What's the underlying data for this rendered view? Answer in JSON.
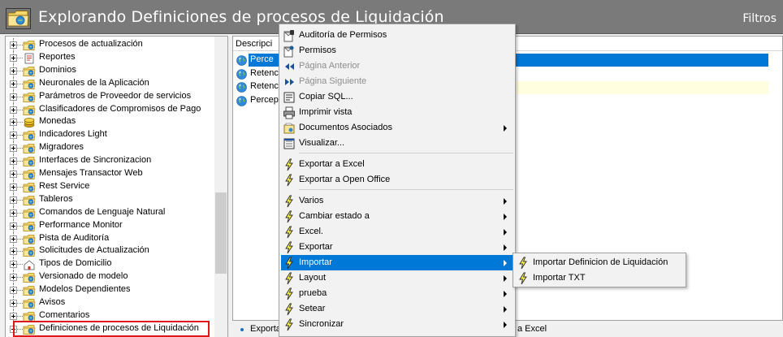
{
  "window": {
    "title": "Explorando Definiciones de procesos de Liquidación",
    "filters_label": "Filtros"
  },
  "tree": {
    "items": [
      {
        "label": "Procesos de actualización",
        "icon": "folder-icon"
      },
      {
        "label": "Reportes",
        "icon": "report-icon"
      },
      {
        "label": "Dominios",
        "icon": "folder-icon"
      },
      {
        "label": "Neuronales de la Aplicación",
        "icon": "folder-icon"
      },
      {
        "label": "Parámetros de Proveedor de servicios",
        "icon": "folder-icon"
      },
      {
        "label": "Clasificadores de Compromisos de Pago",
        "icon": "folder-icon"
      },
      {
        "label": "Monedas",
        "icon": "coins-icon"
      },
      {
        "label": "Indicadores Light",
        "icon": "folder-icon"
      },
      {
        "label": "Migradores",
        "icon": "folder-icon"
      },
      {
        "label": "Interfaces de Sincronizacion",
        "icon": "folder-icon"
      },
      {
        "label": "Mensajes Transactor Web",
        "icon": "folder-icon"
      },
      {
        "label": "Rest Service",
        "icon": "folder-icon"
      },
      {
        "label": "Tableros",
        "icon": "folder-icon"
      },
      {
        "label": "Comandos de Lenguaje Natural",
        "icon": "folder-icon"
      },
      {
        "label": "Performance Monitor",
        "icon": "folder-icon"
      },
      {
        "label": "Pista de Auditoría",
        "icon": "folder-icon"
      },
      {
        "label": "Solicitudes de Actualización",
        "icon": "folder-icon"
      },
      {
        "label": "Tipos de Domicilio",
        "icon": "domicile-icon"
      },
      {
        "label": "Versionado de modelo",
        "icon": "folder-icon"
      },
      {
        "label": "Modelos Dependientes",
        "icon": "folder-icon"
      },
      {
        "label": "Avisos",
        "icon": "folder-icon"
      },
      {
        "label": "Comentarios",
        "icon": "folder-icon"
      },
      {
        "label": "Definiciones de procesos de Liquidación",
        "icon": "folder-icon",
        "selected": true
      }
    ]
  },
  "list": {
    "column_header": "Descripci",
    "rows": [
      {
        "label": "Perce"
      },
      {
        "label": "Retenc"
      },
      {
        "label": "Retenc"
      },
      {
        "label": "Percep"
      }
    ]
  },
  "status": {
    "left_text": "Exporta",
    "right_text": "a Excel"
  },
  "context_menu": {
    "items": [
      {
        "label": "Auditoría de Permisos",
        "icon": "audit-permissions-icon"
      },
      {
        "label": "Permisos",
        "icon": "permissions-icon"
      },
      {
        "label": "Página Anterior",
        "icon": "previous-page-icon",
        "disabled": true
      },
      {
        "label": "Página Siguiente",
        "icon": "next-page-icon",
        "disabled": true
      },
      {
        "label": "Copiar SQL...",
        "icon": "sql-icon"
      },
      {
        "label": "Imprimir vista",
        "icon": "print-icon"
      },
      {
        "label": "Documentos Asociados",
        "icon": "documents-icon",
        "submenu": true
      },
      {
        "label": "Visualizar...",
        "icon": "view-icon"
      },
      {
        "label": "Exportar a Excel",
        "icon": "lightning-icon"
      },
      {
        "label": "Exportar a Open Office",
        "icon": "lightning-icon"
      },
      {
        "label": "Varios",
        "icon": "lightning-icon",
        "submenu": true
      },
      {
        "label": "Cambiar estado a",
        "icon": "lightning-icon",
        "submenu": true
      },
      {
        "label": "Excel.",
        "icon": "lightning-icon",
        "submenu": true
      },
      {
        "label": "Exportar",
        "icon": "lightning-icon",
        "submenu": true
      },
      {
        "label": "Importar",
        "icon": "lightning-icon",
        "submenu": true,
        "active": true
      },
      {
        "label": "Layout",
        "icon": "lightning-icon",
        "submenu": true
      },
      {
        "label": "prueba",
        "icon": "lightning-icon",
        "submenu": true
      },
      {
        "label": "Setear",
        "icon": "lightning-icon",
        "submenu": true
      },
      {
        "label": "Sincronizar",
        "icon": "lightning-icon",
        "submenu": true
      }
    ]
  },
  "submenu": {
    "items": [
      {
        "label": "Importar Definicion de Liquidación",
        "icon": "lightning-icon"
      },
      {
        "label": "Importar TXT",
        "icon": "lightning-icon"
      }
    ]
  },
  "colors": {
    "titlebar": "#7a7a7a",
    "highlight": "#0078d7",
    "selection_border": "#e0161e"
  }
}
